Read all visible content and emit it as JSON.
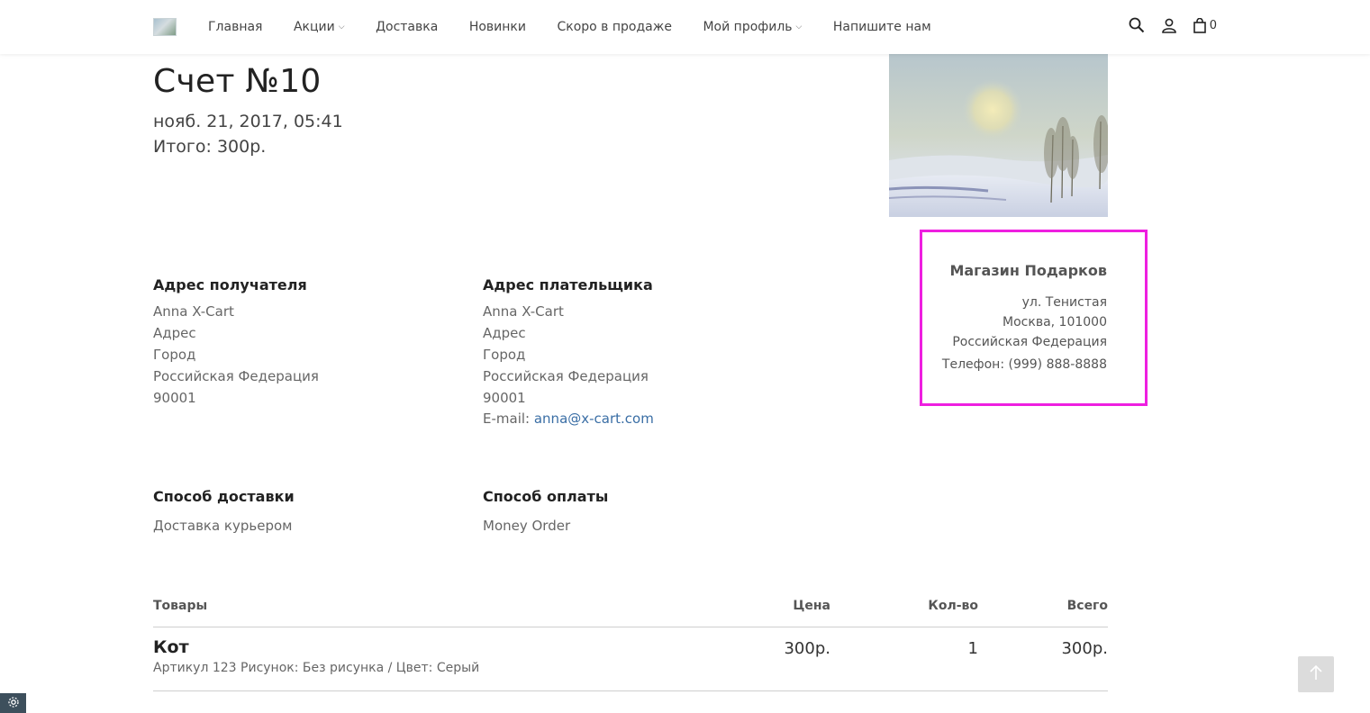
{
  "nav": {
    "items": [
      {
        "label": "Главная"
      },
      {
        "label": "Акции",
        "dropdown": true
      },
      {
        "label": "Доставка"
      },
      {
        "label": "Новинки"
      },
      {
        "label": "Скоро в продаже"
      },
      {
        "label": "Мой профиль",
        "dropdown": true
      },
      {
        "label": "Напишите нам"
      }
    ],
    "icons": [
      "search-icon",
      "user-icon",
      "cart-icon"
    ],
    "cart_count": "0"
  },
  "invoice": {
    "title": "Счет №10",
    "date": "нояб. 21, 2017, 05:41",
    "total": "Итого: 300р."
  },
  "company": {
    "name": "Магазин Подарков",
    "street": "ул. Тенистая",
    "city_zip": "Москва, 101000",
    "country": "Российская Федерация",
    "phone": "Телефон: (999) 888-8888",
    "highlight_color": "#ee1fe0"
  },
  "shipping_address": {
    "title": "Адрес получателя",
    "lines": [
      "Anna X-Cart",
      "Адрес",
      "Город",
      "Российская Федерация",
      "90001"
    ]
  },
  "billing_address": {
    "title": "Адрес плательщика",
    "lines": [
      "Anna X-Cart",
      "Адрес",
      "Город",
      "Российская Федерация",
      "90001"
    ],
    "email_label": "E-mail: ",
    "email": "anna@x-cart.com"
  },
  "shipping_method": {
    "title": "Способ доставки",
    "value": "Доставка курьером"
  },
  "payment_method": {
    "title": "Способ оплаты",
    "value": "Money Order"
  },
  "table": {
    "headers": {
      "items": "Товары",
      "price": "Цена",
      "qty": "Кол-во",
      "total": "Всего"
    },
    "rows": [
      {
        "name": "Кот",
        "meta": "Артикул 123  Рисунок: Без рисунка / Цвет: Серый",
        "price": "300р.",
        "qty": "1",
        "total": "300р."
      }
    ]
  }
}
